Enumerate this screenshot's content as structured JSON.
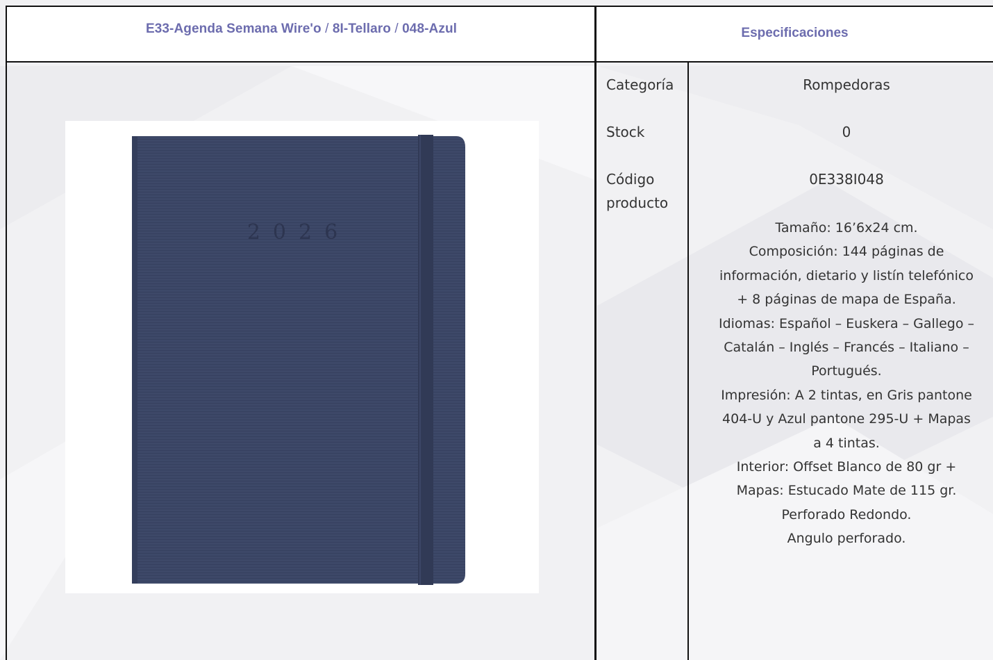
{
  "header": {
    "product_code": "E33-Agenda Semana Wire'o",
    "separator": "/",
    "material": "8I-Tellaro",
    "color": "048-Azul"
  },
  "specs_header": "Especificaciones",
  "product_image": {
    "year_text": "2026",
    "cover_color": "#3c4766",
    "icon": "agenda-product-photo"
  },
  "specs": {
    "category_label": "Categoría",
    "category_value": "Rompedoras",
    "stock_label": "Stock",
    "stock_value": "0",
    "code_label_line1": "Código",
    "code_label_line2": "producto",
    "code_value": "0E338I048",
    "description_lines": [
      "Tamaño: 16’6x24 cm.",
      "Composición: 144 páginas de",
      "información, dietario y listín telefónico",
      "+ 8 páginas de mapa de España.",
      "Idiomas: Español – Euskera – Gallego –",
      "Catalán – Inglés – Francés – Italiano –",
      "Portugués.",
      "Impresión: A 2 tintas, en Gris pantone",
      "404-U y Azul pantone 295-U + Mapas",
      "a 4 tintas.",
      "Interior: Offset Blanco de 80 gr +",
      "Mapas: Estucado Mate de 115 gr.",
      "Perforado Redondo.",
      "Angulo perforado."
    ]
  },
  "colors": {
    "accent": "#6c6cae",
    "border": "#111111",
    "text": "#333333"
  }
}
